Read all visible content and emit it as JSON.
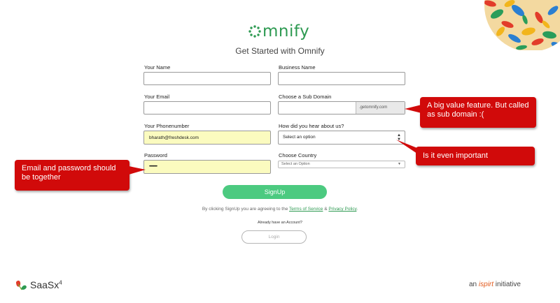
{
  "brand": {
    "logo_text": "mnify",
    "subtitle": "Get Started with Omnify"
  },
  "form": {
    "your_name": {
      "label": "Your Name",
      "value": ""
    },
    "business_name": {
      "label": "Business Name",
      "value": ""
    },
    "your_email": {
      "label": "Your Email",
      "value": ""
    },
    "sub_domain": {
      "label": "Choose a Sub Domain",
      "value": "",
      "suffix": ".getomnify.com"
    },
    "phone": {
      "label": "Your Phonenumber",
      "value": "bharath@freshdesk.com"
    },
    "hear_about": {
      "label": "How did you hear about us?",
      "selected": "Select an option"
    },
    "password": {
      "label": "Password",
      "value": "••••••••••"
    },
    "country": {
      "label": "Choose Country",
      "selected": "Select an Option"
    }
  },
  "signup_label": "SignUp",
  "terms": {
    "prefix": "By clicking SignUp you are agreeing to the ",
    "tos": "Terms of Service",
    "amp": " & ",
    "privacy": "Privacy Policy",
    "suffix": "."
  },
  "already_text": "Already have an Account?",
  "login_label": "Login",
  "callouts": {
    "email_password": "Email and password should be together",
    "sub_domain": "A big value feature. But called as sub domain :(",
    "important": "Is it even important"
  },
  "footer": {
    "saas_text": "SaaSx",
    "saas_sup": "4",
    "initiative_prefix": "an ",
    "initiative_brand": "ispirt",
    "initiative_suffix": " initiative"
  },
  "colors": {
    "brand_green": "#2e9a52",
    "button_green": "#4cca80",
    "callout_red": "#d10a0a",
    "autofill_yellow": "#fbfbbf"
  }
}
